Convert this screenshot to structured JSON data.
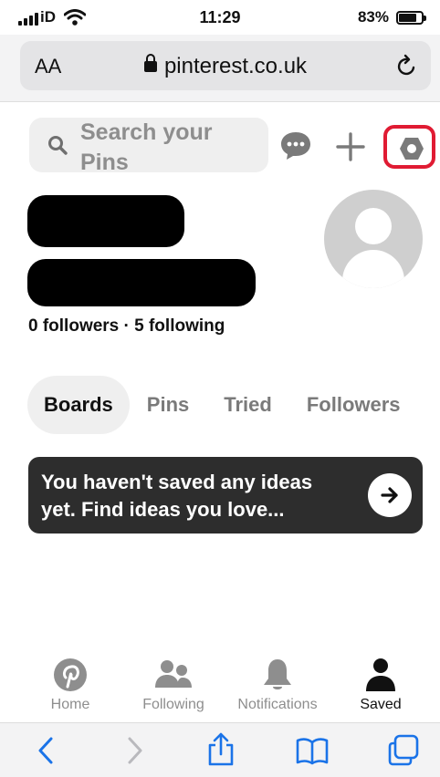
{
  "status_bar": {
    "carrier": "iD",
    "time": "11:29",
    "battery_percent": "83%"
  },
  "browser": {
    "text_size_label": "AA",
    "url": "pinterest.co.uk"
  },
  "header": {
    "search_placeholder": "Search your Pins"
  },
  "profile": {
    "follow_summary": "0 followers · 5 following"
  },
  "tabs": [
    {
      "label": "Boards",
      "active": true
    },
    {
      "label": "Pins",
      "active": false
    },
    {
      "label": "Tried",
      "active": false
    },
    {
      "label": "Followers",
      "active": false
    }
  ],
  "banner": {
    "text": "You haven't saved any ideas yet. Find ideas you love..."
  },
  "bottom_nav": [
    {
      "label": "Home",
      "icon": "pinterest-logo-icon",
      "active": false
    },
    {
      "label": "Following",
      "icon": "people-icon",
      "active": false
    },
    {
      "label": "Notifications",
      "icon": "bell-icon",
      "active": false
    },
    {
      "label": "Saved",
      "icon": "person-icon",
      "active": true
    }
  ],
  "safari_toolbar": {
    "icons": [
      "back-icon",
      "forward-icon",
      "share-icon",
      "bookmarks-icon",
      "tabs-icon"
    ]
  },
  "colors": {
    "highlight_red": "#e01b33",
    "safari_blue": "#1a73e8",
    "banner_bg": "#2d2d2d"
  }
}
